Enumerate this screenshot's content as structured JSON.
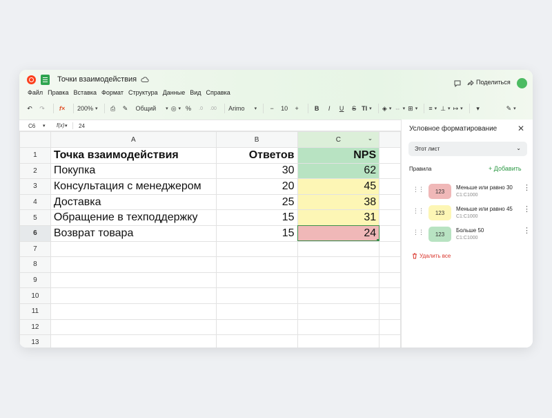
{
  "app": {
    "doc_title": "Точки взаимодействия",
    "menu": [
      "Файл",
      "Правка",
      "Вставка",
      "Формат",
      "Структура",
      "Данные",
      "Вид",
      "Справка"
    ],
    "share_label": "Поделиться"
  },
  "toolbar": {
    "zoom": "200%",
    "number_format": "Общий",
    "font_name": "Arimo",
    "font_size": "10",
    "percent": "%",
    "minus": "−",
    "plus": "+",
    "bold": "B",
    "italic": "I",
    "underline": "U",
    "strike": "S",
    "text_format": "T"
  },
  "formula_bar": {
    "cell_ref": "C6",
    "fx_label": "f(x)",
    "value": "24"
  },
  "sheet": {
    "columns": [
      "A",
      "B",
      "C"
    ],
    "row_numbers": [
      "1",
      "2",
      "3",
      "4",
      "5",
      "6",
      "7",
      "8",
      "9",
      "10",
      "11",
      "12",
      "13"
    ],
    "rows": [
      {
        "a": "Точка взаимодействия",
        "b": "Ответов",
        "c": "NPS"
      },
      {
        "a": "Покупка",
        "b": "30",
        "c": "62"
      },
      {
        "a": "Консультация с менеджером",
        "b": "20",
        "c": "45"
      },
      {
        "a": "Доставка",
        "b": "25",
        "c": "38"
      },
      {
        "a": "Обращение в техподдержку",
        "b": "15",
        "c": "31"
      },
      {
        "a": "Возврат товара",
        "b": "15",
        "c": "24"
      }
    ],
    "active_row": "6"
  },
  "panel": {
    "title": "Условное форматирование",
    "scope": "Этот лист",
    "rules_label": "Правила",
    "add_label": "Добавить",
    "delete_all_label": "Удалить все",
    "rules": [
      {
        "chip": "123",
        "name": "Меньше или равно 30",
        "range": "C1:C1000",
        "color": "#f0b8b8"
      },
      {
        "chip": "123",
        "name": "Меньше или равно 45",
        "range": "C1:C1000",
        "color": "#fdf6b5"
      },
      {
        "chip": "123",
        "name": "Больше 50",
        "range": "C1:C1000",
        "color": "#b8e3c2"
      }
    ]
  },
  "colors": {
    "green_fill": "#b8e3c2",
    "yellow_fill": "#fdf6b5",
    "red_fill": "#f0b8b8",
    "accent": "#2e9a46"
  }
}
